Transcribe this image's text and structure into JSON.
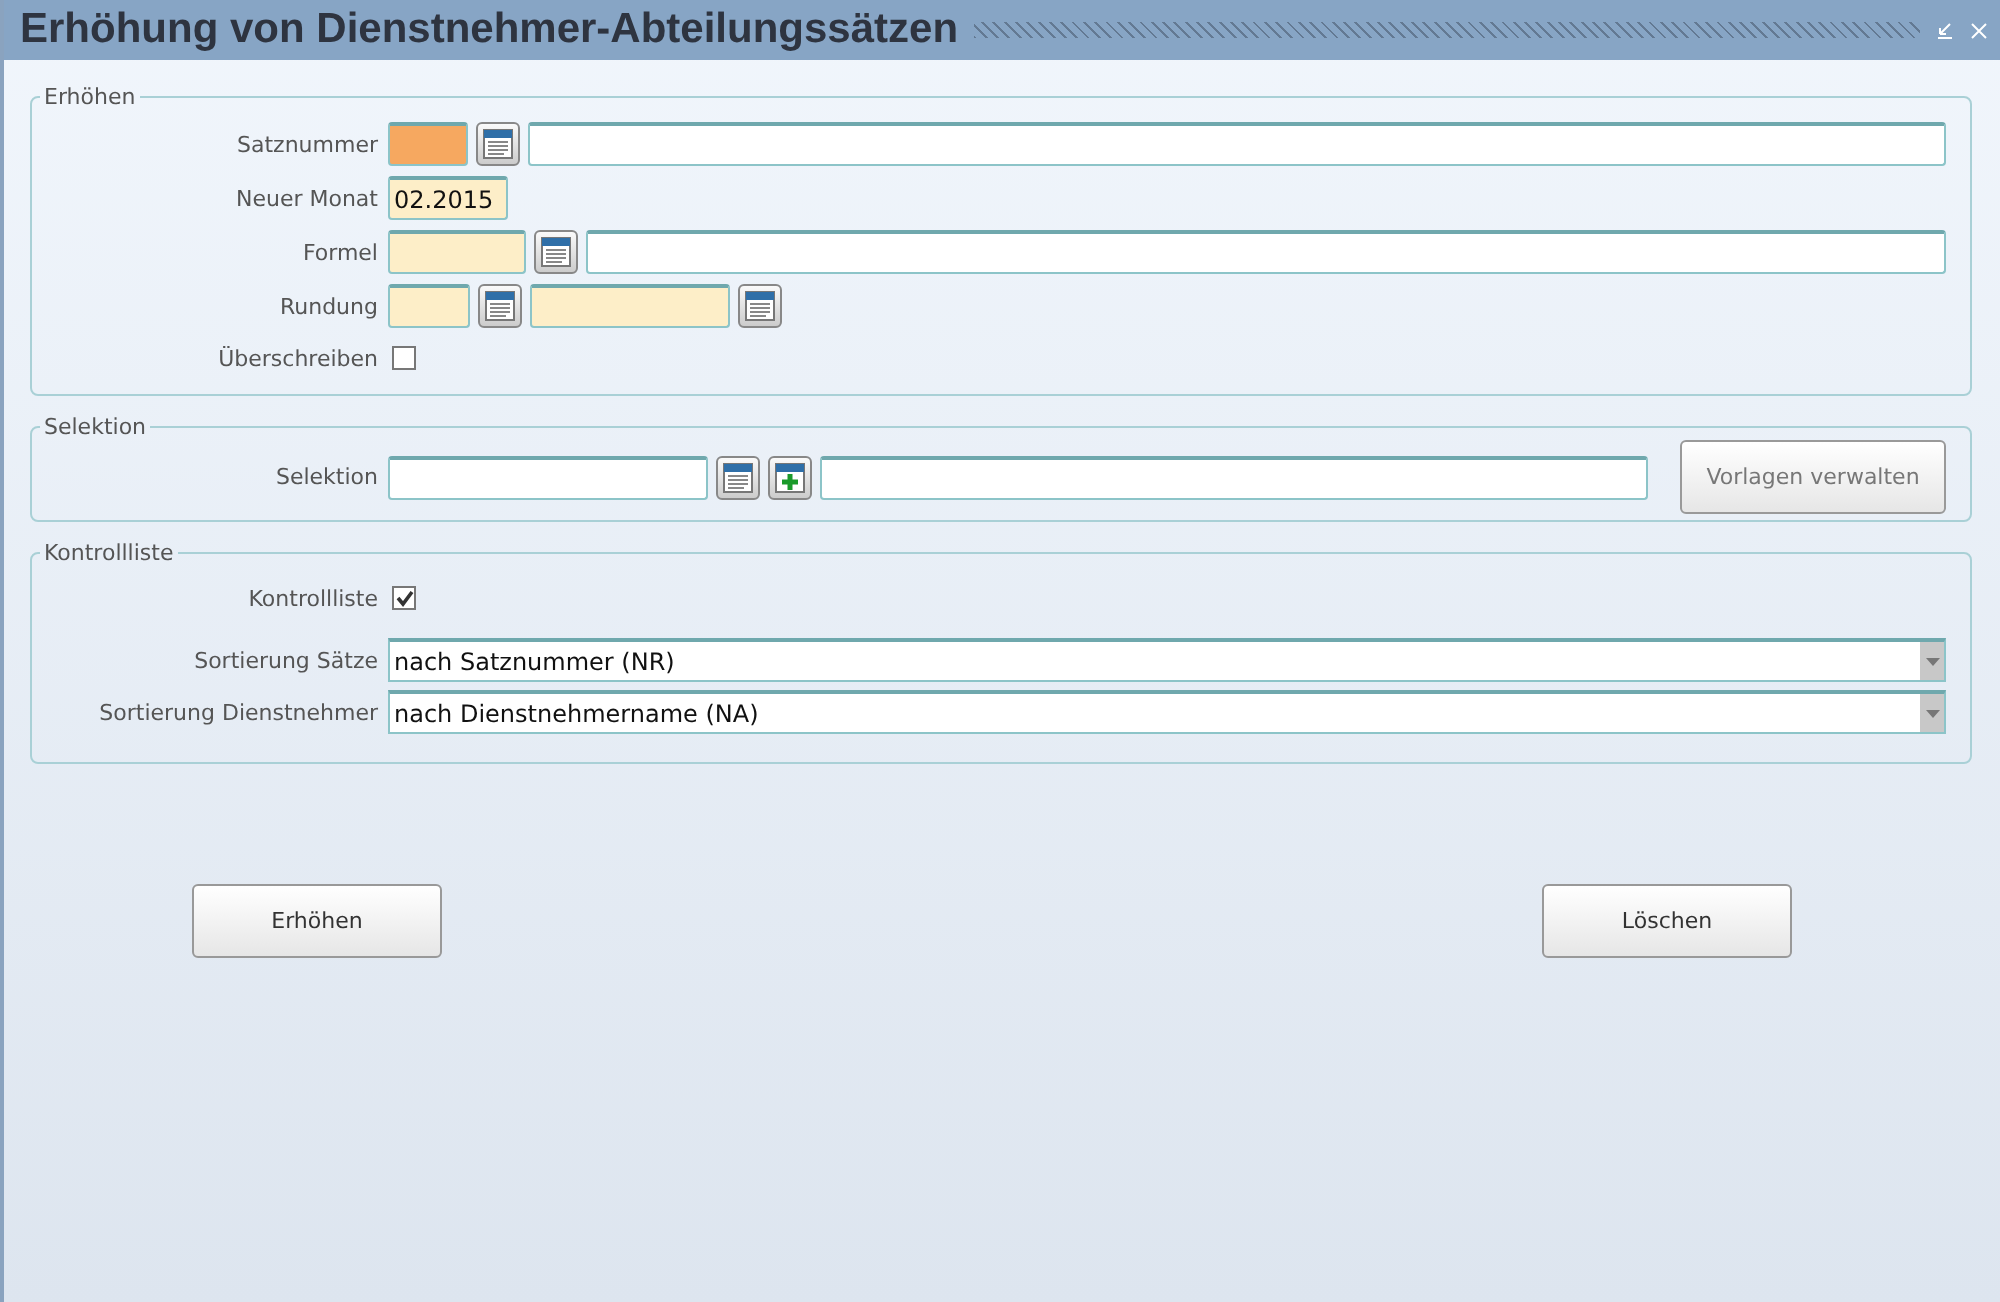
{
  "window": {
    "title": "Erhöhung von Dienstnehmer-Abteilungssätzen"
  },
  "erhoehen": {
    "legend": "Erhöhen",
    "satznummer": {
      "label": "Satznummer",
      "required": true
    },
    "neuer_monat": {
      "label": "Neuer Monat",
      "required": false,
      "value": "02.2015"
    },
    "formel": {
      "label": "Formel",
      "required": false
    },
    "rundung": {
      "label": "Rundung",
      "required": false
    },
    "ueberschreiben": {
      "label": "Überschreiben",
      "checked": false
    }
  },
  "selektion": {
    "legend": "Selektion",
    "label": "Selektion",
    "button": "Vorlagen verwalten"
  },
  "kontrollliste": {
    "legend": "Kontrollliste",
    "kontrollliste": {
      "label": "Kontrollliste",
      "checked": true
    },
    "selects": [
      {
        "label": "Sortierung Sätze",
        "value": "nach Satznummer (NR)"
      },
      {
        "label": "Sortierung Dienstnehmer",
        "value": "nach Dienstnehmername (NA)"
      }
    ]
  },
  "buttons": [
    "Erhöhen",
    "Löschen"
  ]
}
